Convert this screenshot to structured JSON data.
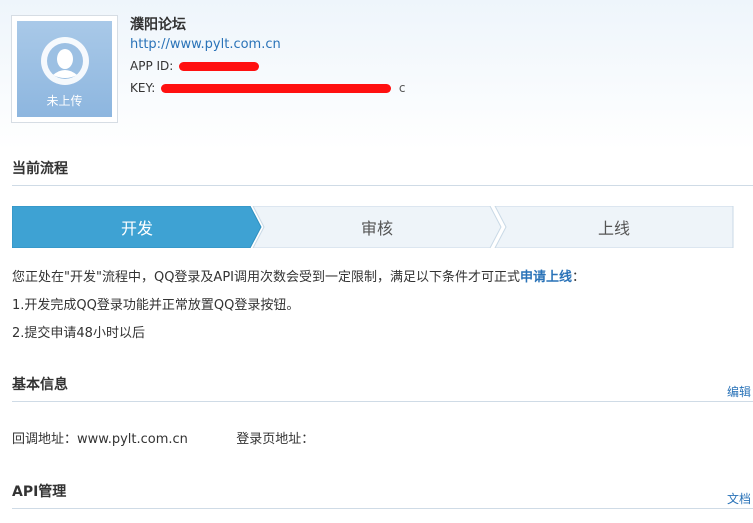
{
  "app": {
    "name": "濮阳论坛",
    "url": "http://www.pylt.com.cn",
    "app_id_label": "APP ID:",
    "key_label": "KEY:",
    "key_tail": "c",
    "logo_caption": "未上传"
  },
  "flow": {
    "title": "当前流程",
    "steps": [
      "开发",
      "审核",
      "上线"
    ],
    "active_step": 0,
    "colors": {
      "active": "#3ea2d3",
      "inactive": "#eef4f9",
      "border": "#c9d9e6"
    }
  },
  "notice": {
    "text_before": "您正处在\"开发\"流程中，QQ登录及API调用次数会受到一定限制，满足以下条件才可正式",
    "link": "申请上线",
    "text_after": "：",
    "item1": "1.开发完成QQ登录功能并正常放置QQ登录按钮。",
    "item2": "2.提交申请48小时以后"
  },
  "basic_info": {
    "title": "基本信息",
    "edit_link": "编辑",
    "callback_label": "回调地址：",
    "callback_value": "www.pylt.com.cn",
    "login_page_label": "登录页地址："
  },
  "api": {
    "title": "API管理",
    "docs_link": "文档"
  }
}
